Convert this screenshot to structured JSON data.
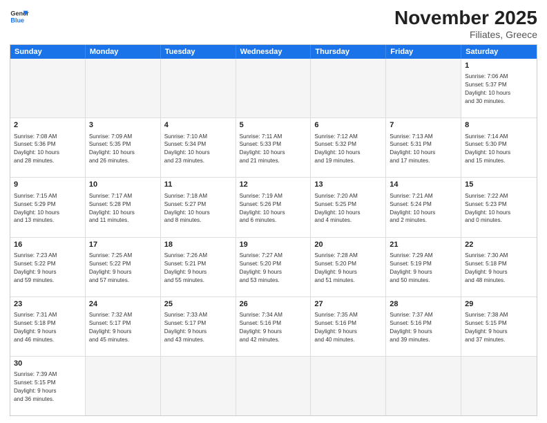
{
  "header": {
    "logo_line1": "General",
    "logo_line2": "Blue",
    "title": "November 2025",
    "location": "Filiates, Greece"
  },
  "days_of_week": [
    "Sunday",
    "Monday",
    "Tuesday",
    "Wednesday",
    "Thursday",
    "Friday",
    "Saturday"
  ],
  "weeks": [
    [
      {
        "day": "",
        "text": ""
      },
      {
        "day": "",
        "text": ""
      },
      {
        "day": "",
        "text": ""
      },
      {
        "day": "",
        "text": ""
      },
      {
        "day": "",
        "text": ""
      },
      {
        "day": "",
        "text": ""
      },
      {
        "day": "1",
        "text": "Sunrise: 7:06 AM\nSunset: 5:37 PM\nDaylight: 10 hours\nand 30 minutes."
      }
    ],
    [
      {
        "day": "2",
        "text": "Sunrise: 7:08 AM\nSunset: 5:36 PM\nDaylight: 10 hours\nand 28 minutes."
      },
      {
        "day": "3",
        "text": "Sunrise: 7:09 AM\nSunset: 5:35 PM\nDaylight: 10 hours\nand 26 minutes."
      },
      {
        "day": "4",
        "text": "Sunrise: 7:10 AM\nSunset: 5:34 PM\nDaylight: 10 hours\nand 23 minutes."
      },
      {
        "day": "5",
        "text": "Sunrise: 7:11 AM\nSunset: 5:33 PM\nDaylight: 10 hours\nand 21 minutes."
      },
      {
        "day": "6",
        "text": "Sunrise: 7:12 AM\nSunset: 5:32 PM\nDaylight: 10 hours\nand 19 minutes."
      },
      {
        "day": "7",
        "text": "Sunrise: 7:13 AM\nSunset: 5:31 PM\nDaylight: 10 hours\nand 17 minutes."
      },
      {
        "day": "8",
        "text": "Sunrise: 7:14 AM\nSunset: 5:30 PM\nDaylight: 10 hours\nand 15 minutes."
      }
    ],
    [
      {
        "day": "9",
        "text": "Sunrise: 7:15 AM\nSunset: 5:29 PM\nDaylight: 10 hours\nand 13 minutes."
      },
      {
        "day": "10",
        "text": "Sunrise: 7:17 AM\nSunset: 5:28 PM\nDaylight: 10 hours\nand 11 minutes."
      },
      {
        "day": "11",
        "text": "Sunrise: 7:18 AM\nSunset: 5:27 PM\nDaylight: 10 hours\nand 8 minutes."
      },
      {
        "day": "12",
        "text": "Sunrise: 7:19 AM\nSunset: 5:26 PM\nDaylight: 10 hours\nand 6 minutes."
      },
      {
        "day": "13",
        "text": "Sunrise: 7:20 AM\nSunset: 5:25 PM\nDaylight: 10 hours\nand 4 minutes."
      },
      {
        "day": "14",
        "text": "Sunrise: 7:21 AM\nSunset: 5:24 PM\nDaylight: 10 hours\nand 2 minutes."
      },
      {
        "day": "15",
        "text": "Sunrise: 7:22 AM\nSunset: 5:23 PM\nDaylight: 10 hours\nand 0 minutes."
      }
    ],
    [
      {
        "day": "16",
        "text": "Sunrise: 7:23 AM\nSunset: 5:22 PM\nDaylight: 9 hours\nand 59 minutes."
      },
      {
        "day": "17",
        "text": "Sunrise: 7:25 AM\nSunset: 5:22 PM\nDaylight: 9 hours\nand 57 minutes."
      },
      {
        "day": "18",
        "text": "Sunrise: 7:26 AM\nSunset: 5:21 PM\nDaylight: 9 hours\nand 55 minutes."
      },
      {
        "day": "19",
        "text": "Sunrise: 7:27 AM\nSunset: 5:20 PM\nDaylight: 9 hours\nand 53 minutes."
      },
      {
        "day": "20",
        "text": "Sunrise: 7:28 AM\nSunset: 5:20 PM\nDaylight: 9 hours\nand 51 minutes."
      },
      {
        "day": "21",
        "text": "Sunrise: 7:29 AM\nSunset: 5:19 PM\nDaylight: 9 hours\nand 50 minutes."
      },
      {
        "day": "22",
        "text": "Sunrise: 7:30 AM\nSunset: 5:18 PM\nDaylight: 9 hours\nand 48 minutes."
      }
    ],
    [
      {
        "day": "23",
        "text": "Sunrise: 7:31 AM\nSunset: 5:18 PM\nDaylight: 9 hours\nand 46 minutes."
      },
      {
        "day": "24",
        "text": "Sunrise: 7:32 AM\nSunset: 5:17 PM\nDaylight: 9 hours\nand 45 minutes."
      },
      {
        "day": "25",
        "text": "Sunrise: 7:33 AM\nSunset: 5:17 PM\nDaylight: 9 hours\nand 43 minutes."
      },
      {
        "day": "26",
        "text": "Sunrise: 7:34 AM\nSunset: 5:16 PM\nDaylight: 9 hours\nand 42 minutes."
      },
      {
        "day": "27",
        "text": "Sunrise: 7:35 AM\nSunset: 5:16 PM\nDaylight: 9 hours\nand 40 minutes."
      },
      {
        "day": "28",
        "text": "Sunrise: 7:37 AM\nSunset: 5:16 PM\nDaylight: 9 hours\nand 39 minutes."
      },
      {
        "day": "29",
        "text": "Sunrise: 7:38 AM\nSunset: 5:15 PM\nDaylight: 9 hours\nand 37 minutes."
      }
    ],
    [
      {
        "day": "30",
        "text": "Sunrise: 7:39 AM\nSunset: 5:15 PM\nDaylight: 9 hours\nand 36 minutes."
      },
      {
        "day": "",
        "text": ""
      },
      {
        "day": "",
        "text": ""
      },
      {
        "day": "",
        "text": ""
      },
      {
        "day": "",
        "text": ""
      },
      {
        "day": "",
        "text": ""
      },
      {
        "day": "",
        "text": ""
      }
    ]
  ]
}
